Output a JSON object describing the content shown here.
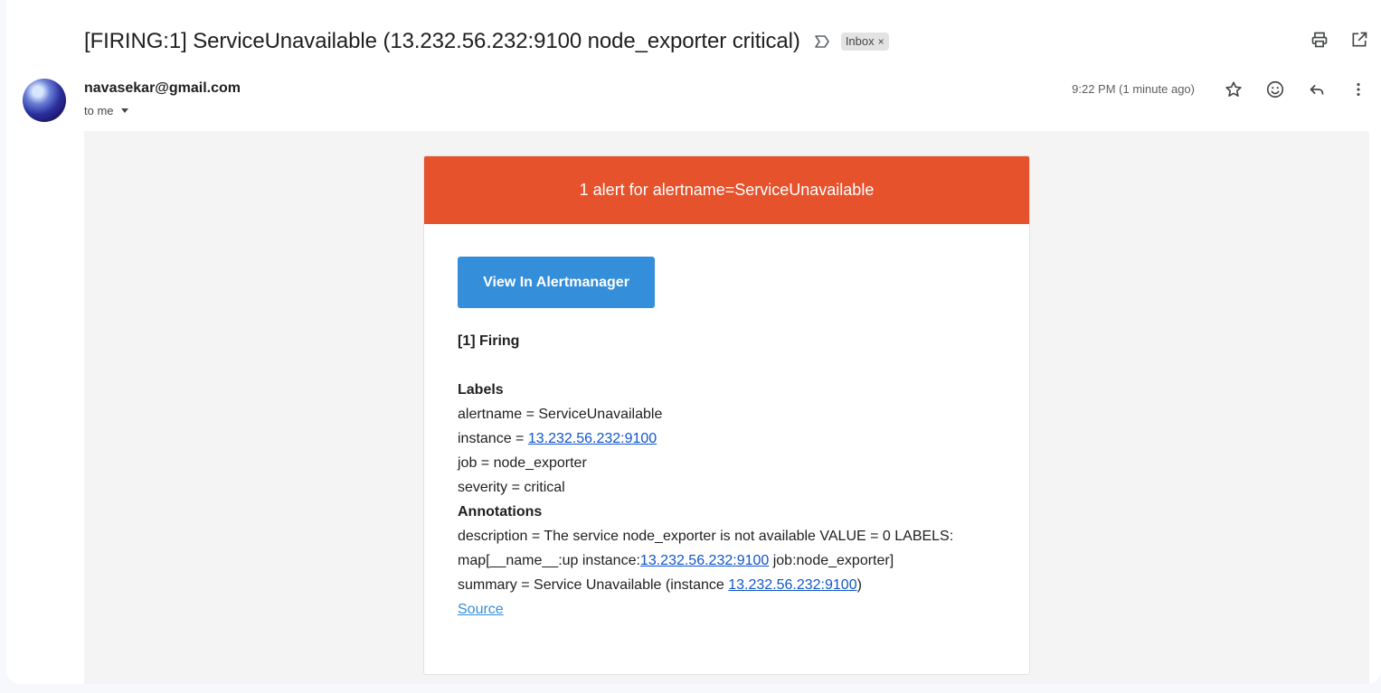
{
  "email": {
    "subject": "[FIRING:1] ServiceUnavailable (13.232.56.232:9100 node_exporter critical)",
    "label_chip": "Inbox",
    "label_chip_close": "×",
    "sender": "navasekar@gmail.com",
    "recipient": "to me",
    "time": "9:22 PM (1 minute ago)"
  },
  "alert": {
    "header": "1 alert for alertname=ServiceUnavailable",
    "button_label": "View In Alertmanager",
    "firing_label": "[1] Firing",
    "labels_heading": "Labels",
    "labels": {
      "alertname": "alertname = ServiceUnavailable",
      "instance_prefix": "instance = ",
      "instance_link": "13.232.56.232:9100",
      "job": "job = node_exporter",
      "severity": "severity = critical"
    },
    "annotations_heading": "Annotations",
    "annotations": {
      "description_line1": "description = The service node_exporter is not available VALUE = 0 LABELS:",
      "description_line2_prefix": "map[__name__:up instance:",
      "description_line2_link": "13.232.56.232:9100",
      "description_line2_suffix": " job:node_exporter]",
      "summary_prefix": "summary = Service Unavailable (instance ",
      "summary_link": "13.232.56.232:9100",
      "summary_suffix": ")"
    },
    "source_link": "Source"
  },
  "icons": {
    "important": "important-marker-icon",
    "print": "print-icon",
    "open_new_window": "open-in-new-window-icon",
    "star": "star-icon",
    "emoji": "emoji-reaction-icon",
    "reply": "reply-icon",
    "more": "more-vertical-icon"
  },
  "colors": {
    "alert_header": "#e6522c",
    "button": "#348eda",
    "link": "#1155cc"
  }
}
